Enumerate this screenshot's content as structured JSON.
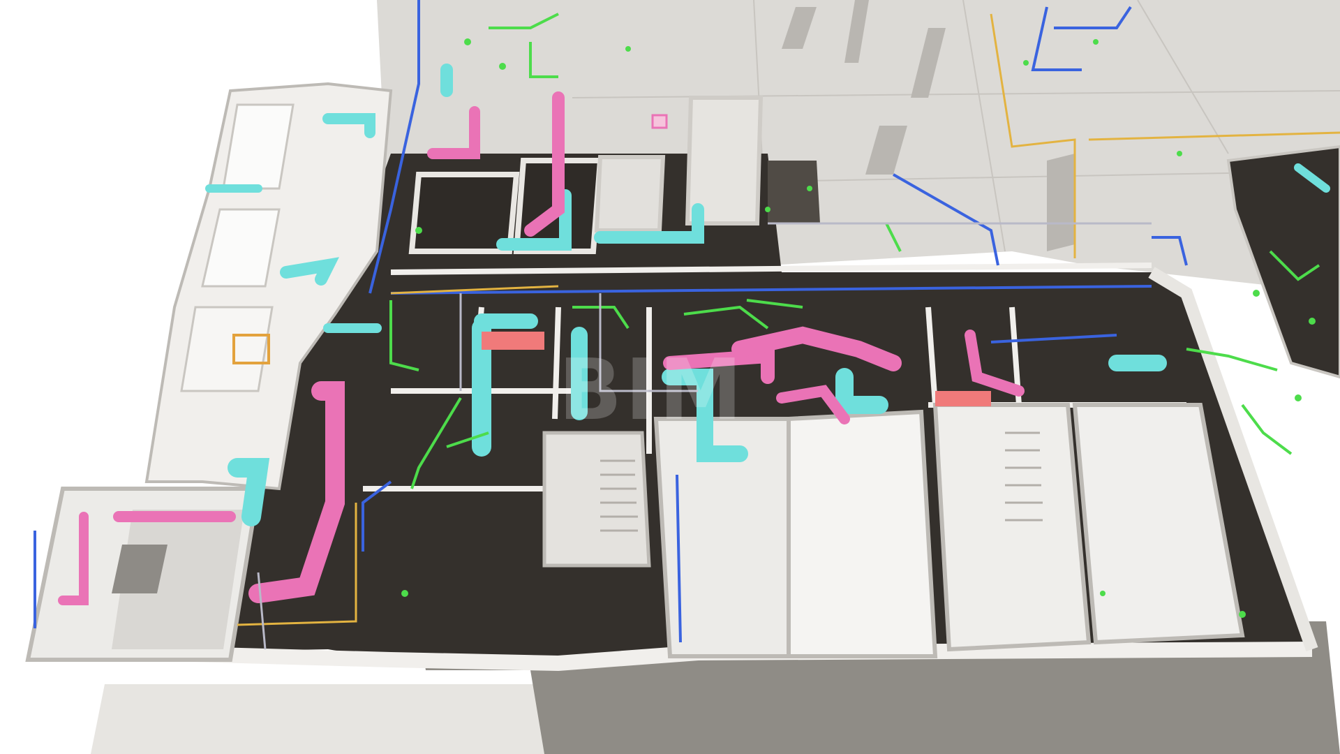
{
  "scene": {
    "subject": "mep-model-cutaway",
    "colors": {
      "background": "#ffffff",
      "slab": "#dcdad6",
      "floor": "#34302c",
      "wall": "#f1efec",
      "wall_edge": "#bdbab5",
      "supply_duct": "#6fdfdc",
      "return_duct": "#ea73b6",
      "exhaust_duct": "#f07a7a",
      "hot_water_pipe": "#3a63df",
      "cold_water_pipe": "#4ddc4b",
      "gas_pipe": "#e3b341",
      "utility_line": "#b9b9c8"
    }
  },
  "watermark": {
    "text": "BIM"
  }
}
